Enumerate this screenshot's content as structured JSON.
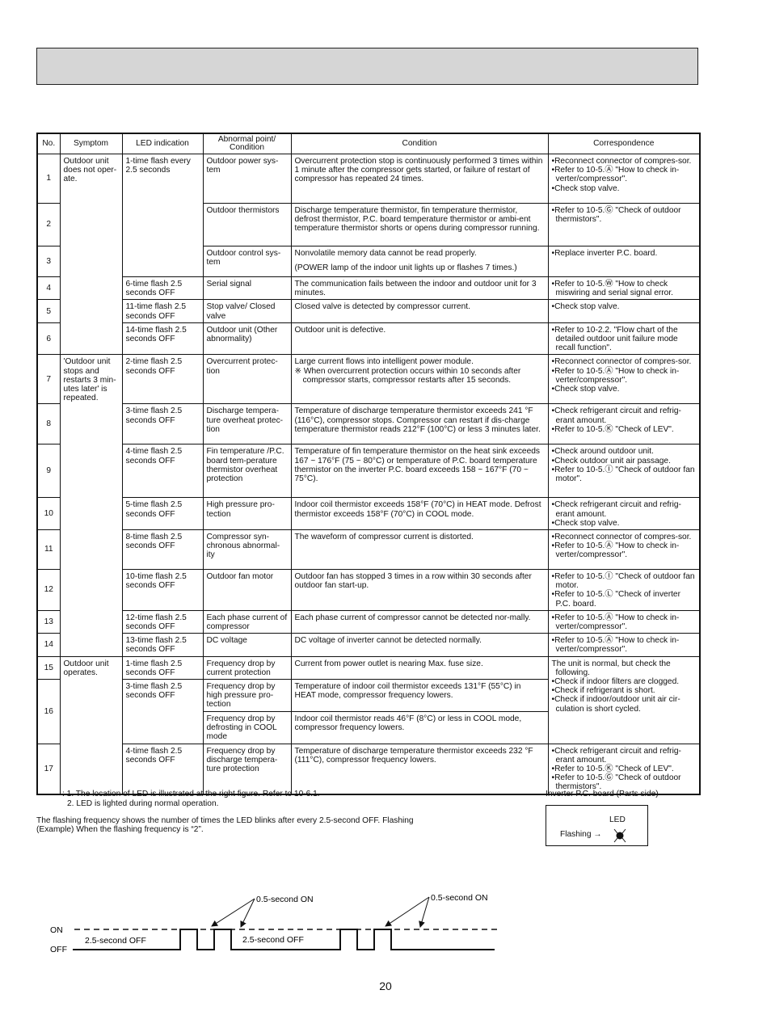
{
  "header_band": {
    "title": ""
  },
  "table": {
    "headers": {
      "no": "No.",
      "symptom": "Symptom",
      "led": "LED indication",
      "abnormal": "Abnormal point/ Condition",
      "condition": "Condition",
      "correspondence": "Correspondence"
    },
    "symptoms": {
      "s1": "Outdoor unit does not oper-ate.",
      "s2": "'Outdoor unit stops and restarts 3 min-utes later' is repeated.",
      "s3": "Outdoor unit operates."
    },
    "rows": [
      {
        "no": "1",
        "led": "1-time flash every 2.5 seconds",
        "abnormal": "Outdoor power sys-tem",
        "condition": "Overcurrent protection stop is continuously performed 3 times within 1 minute after the compressor gets started, or failure of restart of compressor has repeated 24 times.",
        "corr": [
          "•Reconnect connector of compres-sor.",
          "•Refer to 10-5.Ⓐ \"How to check in-verter/compressor\".",
          "•Check stop valve."
        ]
      },
      {
        "no": "2",
        "led": "",
        "abnormal": "Outdoor thermistors",
        "condition": "Discharge temperature thermistor, fin temperature thermistor, defrost thermistor, P.C. board temperature thermistor or ambi-ent temperature thermistor shorts or opens during compressor running.",
        "corr": [
          "•Refer to 10-5.Ⓖ \"Check of outdoor thermistors\"."
        ]
      },
      {
        "no": "3",
        "led": "",
        "abnormal": "Outdoor control sys-tem",
        "condition": "Nonvolatile memory data cannot be read properly.",
        "condition_note": "(POWER lamp of the indoor unit lights up or flashes 7 times.)",
        "corr": [
          "•Replace inverter P.C. board."
        ]
      },
      {
        "no": "4",
        "led": "6-time flash 2.5 seconds OFF",
        "abnormal": "Serial signal",
        "condition": "The communication fails between the indoor and outdoor unit for 3 minutes.",
        "corr": [
          "•Refer to 10-5.Ⓦ \"How to check miswiring and serial signal error."
        ]
      },
      {
        "no": "5",
        "led": "11-time flash 2.5 seconds OFF",
        "abnormal": "Stop valve/ Closed valve",
        "condition": "Closed valve is detected by compressor current.",
        "corr": [
          "•Check stop valve."
        ]
      },
      {
        "no": "6",
        "led": "14-time flash 2.5 seconds OFF",
        "abnormal": "Outdoor unit (Other abnormality)",
        "condition": "Outdoor unit is defective.",
        "corr": [
          "•Refer to 10-2.2. \"Flow chart of the detailed outdoor unit failure mode recall function\"."
        ]
      },
      {
        "no": "7",
        "led": "2-time flash 2.5 seconds OFF",
        "abnormal": "Overcurrent protec-tion",
        "condition": "Large current flows into intelligent power module.",
        "condition_note": "※ When overcurrent protection occurs within 10 seconds after compressor starts, compressor restarts after 15 seconds.",
        "corr": [
          "•Reconnect connector of compres-sor.",
          "•Refer to 10-5.Ⓐ \"How to check in-verter/compressor\".",
          "•Check stop valve."
        ]
      },
      {
        "no": "8",
        "led": "3-time flash 2.5 seconds OFF",
        "abnormal": "Discharge tempera-ture overheat protec-tion",
        "condition": "Temperature of discharge temperature thermistor exceeds 241 °F (116°C), compressor stops. Compressor can restart if dis-charge temperature thermistor reads 212°F (100°C) or less 3 minutes later.",
        "corr": [
          "•Check refrigerant circuit and refrig-erant amount.",
          "•Refer to 10-5.Ⓚ \"Check of LEV\"."
        ]
      },
      {
        "no": "9",
        "led": "4-time flash 2.5 seconds OFF",
        "abnormal": "Fin temperature /P.C. board tem-perature thermistor overheat protection",
        "condition": "Temperature of fin temperature thermistor on the heat sink exceeds 167 ~ 176°F (75 ~ 80°C) or temperature of P.C. board temperature thermistor on the inverter P.C. board exceeds 158 ~ 167°F (70 ~ 75°C).",
        "corr": [
          "•Check around outdoor unit.",
          "•Check outdoor unit air passage.",
          "•Refer to 10-5.Ⓘ \"Check of outdoor fan motor\"."
        ]
      },
      {
        "no": "10",
        "led": "5-time flash 2.5 seconds OFF",
        "abnormal": "High pressure pro-tection",
        "condition": "Indoor coil thermistor exceeds 158°F (70°C) in HEAT mode. Defrost thermistor exceeds 158°F (70°C) in COOL mode.",
        "corr": [
          "•Check refrigerant circuit and refrig-erant amount.",
          "•Check stop valve."
        ]
      },
      {
        "no": "11",
        "led": "8-time flash 2.5 seconds OFF",
        "abnormal": "Compressor syn-chronous abnormal-ity",
        "condition": "The waveform of compressor current is distorted.",
        "corr": [
          "•Reconnect connector of compres-sor.",
          "•Refer to 10-5.Ⓐ \"How to check in-verter/compressor\"."
        ]
      },
      {
        "no": "12",
        "led": "10-time flash 2.5 seconds OFF",
        "abnormal": "Outdoor fan motor",
        "condition": "Outdoor fan has stopped 3 times in a row within 30 seconds after outdoor fan start-up.",
        "corr": [
          "•Refer to 10-5.Ⓘ \"Check of outdoor fan motor.",
          "•Refer to 10-5.Ⓛ \"Check of inverter P.C. board."
        ]
      },
      {
        "no": "13",
        "led": "12-time flash 2.5 seconds OFF",
        "abnormal": "Each phase current of compressor",
        "condition": "Each phase current of compressor cannot be detected nor-mally.",
        "corr": [
          "•Refer to 10-5.Ⓐ \"How to check in-verter/compressor\"."
        ]
      },
      {
        "no": "14",
        "led": "13-time flash 2.5 seconds OFF",
        "abnormal": "DC voltage",
        "condition": "DC voltage of inverter cannot be detected normally.",
        "corr": [
          "•Refer to 10-5.Ⓐ \"How to check in-verter/compressor\"."
        ]
      },
      {
        "no": "15",
        "led": "1-time flash 2.5 seconds OFF",
        "abnormal": "Frequency drop by current protection",
        "condition": "Current from power outlet is nearing Max. fuse size.",
        "corr": [
          " The unit is normal, but check the following.",
          "•Check if indoor filters are clogged.",
          "•Check if refrigerant is short.",
          "•Check if indoor/outdoor unit air cir-culation is short cycled."
        ]
      },
      {
        "no": "16",
        "led": "3-time flash 2.5 seconds OFF",
        "abnormal": "Frequency drop by high pressure pro-tection",
        "condition": "Temperature of indoor coil thermistor exceeds 131°F (55°C) in HEAT mode, compressor frequency lowers.",
        "abnormal_b": "Frequency drop by defrosting in COOL mode",
        "condition_b": "Indoor coil thermistor reads 46°F (8°C) or less in COOL mode, compressor frequency lowers."
      },
      {
        "no": "17",
        "led": "4-time flash 2.5 seconds OFF",
        "abnormal": "Frequency drop by discharge tempera-ture protection",
        "condition": "Temperature of discharge temperature thermistor exceeds 232 °F (111°C), compressor frequency lowers.",
        "corr": [
          "•Check refrigerant circuit and refrig-erant amount.",
          "•Refer to 10-5.Ⓚ \"Check of LEV\".",
          "•Refer to 10-5.Ⓖ \"Check of outdoor thermistors\"."
        ]
      }
    ]
  },
  "notes": {
    "n1": ": 1. The location of LED is illustrated at the right figure. Refer to 10-6.1.",
    "n2": "2. LED is lighted during normal operation."
  },
  "flash_description": {
    "line1": "The flashing frequency shows the number of times the LED blinks after every 2.5-second OFF. Flashing",
    "line2": "(Example) When the flashing frequency is “2”."
  },
  "inverter_figure": {
    "title": "Inverter P.C. board (Parts side)",
    "led_label": "LED",
    "flashing_label": "Flashing →"
  },
  "timing_diagram": {
    "on_label": "ON",
    "off_label": "OFF",
    "off_period_label": "2.5-second OFF",
    "on_period_label": "0.5-second ON"
  },
  "page_number": "20"
}
